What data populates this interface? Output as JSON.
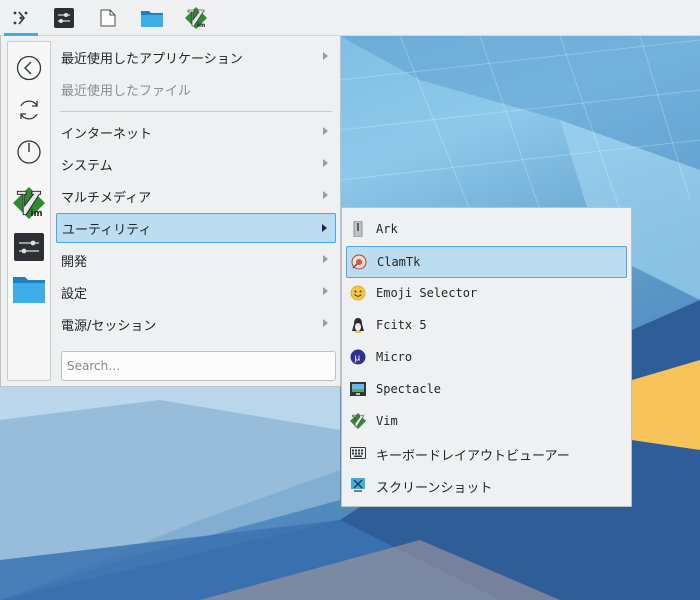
{
  "panel": {
    "buttons": [
      {
        "name": "application-launcher-button",
        "icon": "launcher-icon",
        "active": true
      },
      {
        "name": "system-settings-button",
        "icon": "settings-sliders-icon"
      },
      {
        "name": "new-document-button",
        "icon": "document-icon"
      },
      {
        "name": "file-manager-button",
        "icon": "folder-icon"
      },
      {
        "name": "vim-button",
        "icon": "vim-icon"
      }
    ]
  },
  "sidebar": {
    "items": [
      {
        "name": "back-button",
        "icon": "back-arrow-icon"
      },
      {
        "name": "restart-button",
        "icon": "refresh-icon"
      },
      {
        "name": "shutdown-button",
        "icon": "power-icon"
      },
      {
        "name": "favorite-vim",
        "icon": "vim-icon"
      },
      {
        "name": "favorite-system-settings",
        "icon": "settings-sliders-icon"
      },
      {
        "name": "favorite-file-manager",
        "icon": "folder-icon"
      }
    ]
  },
  "menu": {
    "items": [
      {
        "label": "最近使用したアプリケーション",
        "arrow": true
      },
      {
        "label": "最近使用したファイル",
        "disabled": true
      },
      {
        "label": "インターネット",
        "arrow": true
      },
      {
        "label": "システム",
        "arrow": true
      },
      {
        "label": "マルチメディア",
        "arrow": true
      },
      {
        "label": "ユーティリティ",
        "arrow": true,
        "highlight": true
      },
      {
        "label": "開発",
        "arrow": true
      },
      {
        "label": "設定",
        "arrow": true
      },
      {
        "label": "電源/セッション",
        "arrow": true
      }
    ],
    "search_placeholder": "Search…"
  },
  "submenu": {
    "items": [
      {
        "label": "Ark",
        "icon": "ark-icon"
      },
      {
        "label": "ClamTk",
        "icon": "clamtk-icon",
        "highlight": true
      },
      {
        "label": "Emoji Selector",
        "icon": "emoji-icon"
      },
      {
        "label": "Fcitx 5",
        "icon": "penguin-icon"
      },
      {
        "label": "Micro",
        "icon": "micro-icon"
      },
      {
        "label": "Spectacle",
        "icon": "spectacle-icon"
      },
      {
        "label": "Vim",
        "icon": "vim-icon"
      },
      {
        "label": "キーボードレイアウトビューアー",
        "icon": "keyboard-icon",
        "jp": true
      },
      {
        "label": "スクリーンショット",
        "icon": "screenshot-icon",
        "jp": true
      }
    ]
  },
  "colors": {
    "accent": "#3daee9",
    "highlight_bg": "#bcdcf0",
    "menu_bg": "#eff0f1",
    "text": "#232629"
  }
}
